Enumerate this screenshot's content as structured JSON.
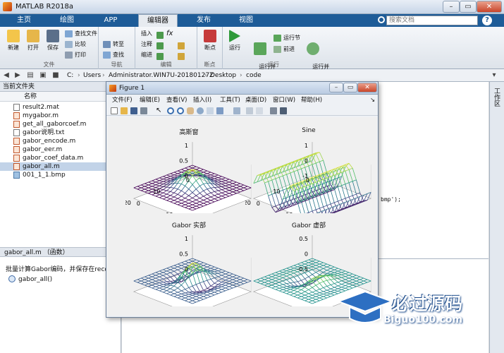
{
  "window": {
    "title": "MATLAB R2018a"
  },
  "tabs": [
    "主页",
    "绘图",
    "APP",
    "编辑器",
    "发布",
    "视图"
  ],
  "active_tab": "编辑器",
  "search": {
    "placeholder": "搜索文档"
  },
  "ribbon": {
    "file_group": {
      "label": "文件",
      "new": "新建",
      "open": "打开",
      "save": "保存",
      "find_files": "查找文件",
      "compare": "比较",
      "print": "打印"
    },
    "nav_group": {
      "label": "导航",
      "goto": "转至",
      "find": "查找"
    },
    "edit_group": {
      "label": "编辑",
      "insert": "插入",
      "comment": "注释",
      "indent": "缩进",
      "fx": "fx"
    },
    "breakpoint_group": {
      "label": "断点",
      "breakpoints": "断点"
    },
    "run_group": {
      "label": "运行",
      "run": "运行",
      "run_advance": "运行并\n前进",
      "run_section": "运行节",
      "advance": "前进",
      "run_time": "运行并\n计时"
    }
  },
  "address": {
    "drive": "C:",
    "parts": [
      "Users",
      "Administrator.WIN7U-20180127Z",
      "Desktop",
      "code"
    ]
  },
  "current_folder": {
    "title": "当前文件夹",
    "column": "名称",
    "files": [
      {
        "name": "result2.mat",
        "type": "mat"
      },
      {
        "name": "mygabor.m",
        "type": "m"
      },
      {
        "name": "get_all_gaborcoef.m",
        "type": "m"
      },
      {
        "name": "gabor说明.txt",
        "type": "txt"
      },
      {
        "name": "gabor_encode.m",
        "type": "m"
      },
      {
        "name": "gabor_eer.m",
        "type": "m"
      },
      {
        "name": "gabor_coef_data.m",
        "type": "m"
      },
      {
        "name": "gabor_all.m",
        "type": "m",
        "selected": true
      },
      {
        "name": "001_1_1.bmp",
        "type": "bmp"
      }
    ],
    "detail_header": "gabor_all.m （函数）",
    "detail_text": "批量计算Gabor编码，并保存在recd中",
    "detail_fn": "gabor_all()"
  },
  "editor": {
    "visible_code": "bmp');"
  },
  "workspace_tab": "工作区",
  "figure": {
    "title": "Figure 1",
    "menus": [
      "文件(F)",
      "编辑(E)",
      "查看(V)",
      "插入(I)",
      "工具(T)",
      "桌面(D)",
      "窗口(W)",
      "帮助(H)"
    ],
    "plots": [
      {
        "title": "高斯窗",
        "z_ticks": [
          "1",
          "0.5",
          "0"
        ],
        "x_ticks": [
          "0",
          "10",
          "20"
        ],
        "y_ticks": [
          "20",
          "10",
          "0"
        ]
      },
      {
        "title": "Sine",
        "z_ticks": [
          "1",
          "0",
          "-1"
        ],
        "x_ticks": [
          "0",
          "10",
          "20"
        ],
        "y_ticks": [
          "20",
          "10",
          "0"
        ]
      },
      {
        "title": "Gabor 实部",
        "z_ticks": [
          "1",
          "0.5",
          "0"
        ],
        "x_ticks": [],
        "y_ticks": []
      },
      {
        "title": "Gabor 虚部",
        "z_ticks": [
          "0.5",
          "0",
          "-0.5"
        ],
        "x_ticks": [],
        "y_ticks": []
      }
    ]
  },
  "watermark": {
    "text": "必过源码",
    "url": "Biguo100.com"
  },
  "colors": {
    "tab_bar": "#1e5c98",
    "accent": "#2b6cb0"
  }
}
